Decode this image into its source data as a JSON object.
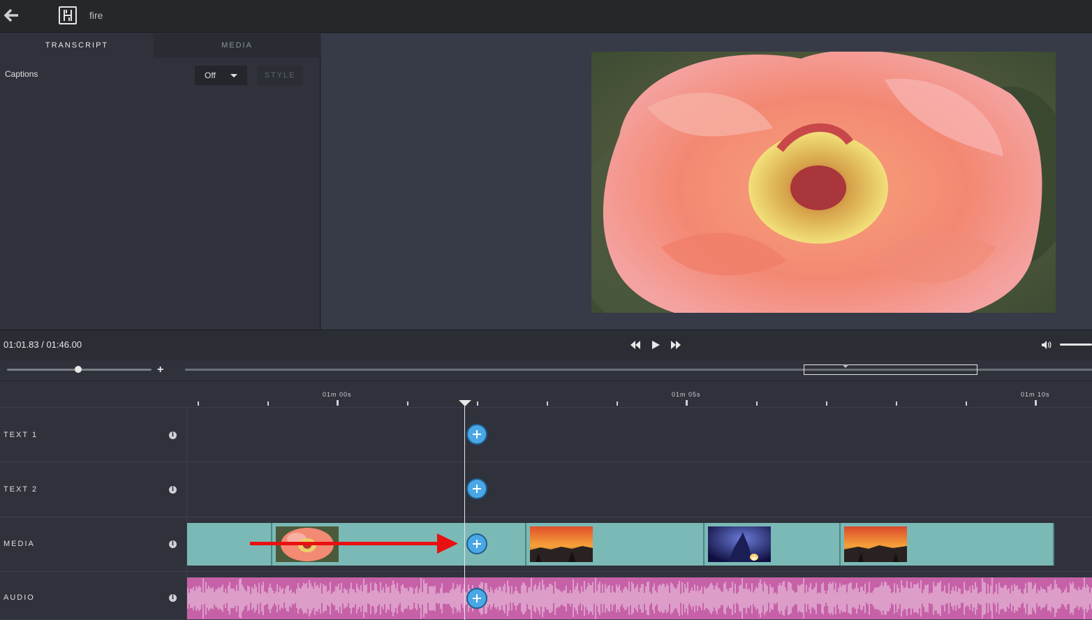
{
  "header": {
    "project_title": "fire",
    "logo_letter": "H"
  },
  "left_panel": {
    "tabs": [
      {
        "label": "TRANSCRIPT",
        "active": true
      },
      {
        "label": "MEDIA",
        "active": false
      }
    ],
    "captions_label": "Captions",
    "captions_value": "Off",
    "style_label": "STYLE"
  },
  "player": {
    "timecode": "01:01.83 / 01:46.00",
    "icons": [
      "rewind-icon",
      "play-icon",
      "fast-forward-icon",
      "volume-icon"
    ],
    "volume_level": 1.0
  },
  "zoom": {
    "plus_label": "+",
    "level": 0.49
  },
  "ruler": {
    "labels": [
      "01m 00s",
      "01m 05s",
      "01m 10s"
    ]
  },
  "tracks": {
    "text1_label": "TEXT 1",
    "text2_label": "TEXT 2",
    "media_label": "MEDIA",
    "audio_label": "AUDIO",
    "info_glyph": "i"
  },
  "media_clips": [
    "flower",
    "sunset",
    "campfire",
    "sunset"
  ],
  "colors": {
    "accent_blue": "#4aa7e6",
    "media_track": "#7bb9b6",
    "audio_track": "#c661a8",
    "annotation_arrow": "#e81010"
  }
}
